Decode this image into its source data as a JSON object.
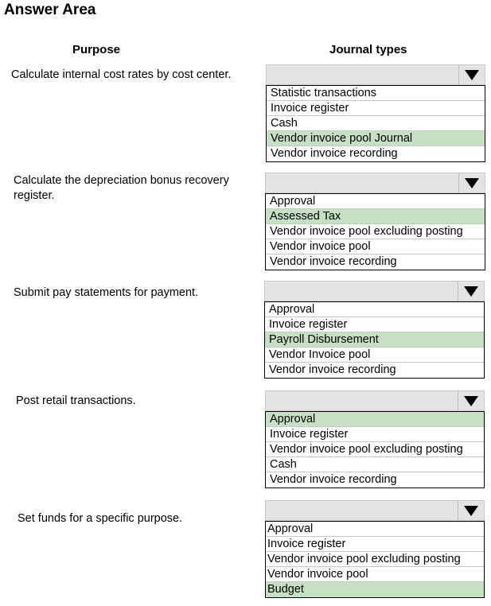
{
  "title": "Answer Area",
  "headers": {
    "purpose": "Purpose",
    "journal_types": "Journal types"
  },
  "colors": {
    "selected_bg": "#c6e0c4",
    "select_bg": "#e3e3e3"
  },
  "rows": [
    {
      "purpose": "Calculate internal cost rates by cost center.",
      "select_value": "",
      "options": [
        "Statistic transactions",
        "Invoice register",
        "Cash",
        "Vendor invoice pool Journal",
        "Vendor invoice recording"
      ],
      "selected_index": 3
    },
    {
      "purpose": "Calculate the depreciation bonus recovery register.",
      "select_value": "",
      "options": [
        "Approval",
        "Assessed Tax",
        "Vendor invoice pool excluding posting",
        "Vendor invoice pool",
        "Vendor invoice recording"
      ],
      "selected_index": 1
    },
    {
      "purpose": "Submit pay statements for payment.",
      "select_value": "",
      "options": [
        "Approval",
        "Invoice register",
        "Payroll Disbursement",
        "Vendor Invoice pool",
        "Vendor invoice recording"
      ],
      "selected_index": 2
    },
    {
      "purpose": "Post retail transactions.",
      "select_value": "",
      "options": [
        "Approval",
        "Invoice register",
        "Vendor invoice pool excluding posting",
        "Cash",
        "Vendor invoice recording"
      ],
      "selected_index": 0
    },
    {
      "purpose": "Set funds for a specific purpose.",
      "select_value": "",
      "options": [
        "Approval",
        "Invoice register",
        "Vendor invoice pool excluding posting",
        "Vendor invoice pool",
        "Budget"
      ],
      "selected_index": 4
    }
  ],
  "icons": {
    "dropdown": "triangle-down-icon"
  }
}
